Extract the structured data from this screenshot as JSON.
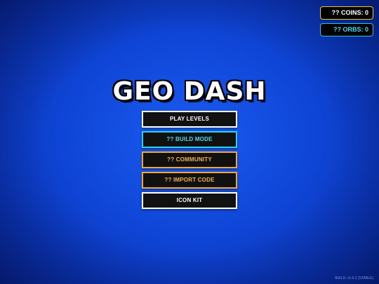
{
  "counters": {
    "coins_label": "?? COINS: 0",
    "orbs_label": "?? ORBS: 0"
  },
  "title": "GEO DASH",
  "menu": {
    "play_levels": "PLAY LEVELS",
    "build_mode": "?? BUILD MODE",
    "community": "?? COMMUNITY",
    "import_code": "?? IMPORT CODE",
    "icon_kit": "ICON KIT"
  },
  "build_info": "BUILD: v1.0.2 (STABLE)",
  "colors": {
    "background": "#0f45d6",
    "coins_border": "#f4c430",
    "orbs_accent": "#22c7e6",
    "orange_accent": "#f0a73a",
    "button_fill": "#111111"
  }
}
